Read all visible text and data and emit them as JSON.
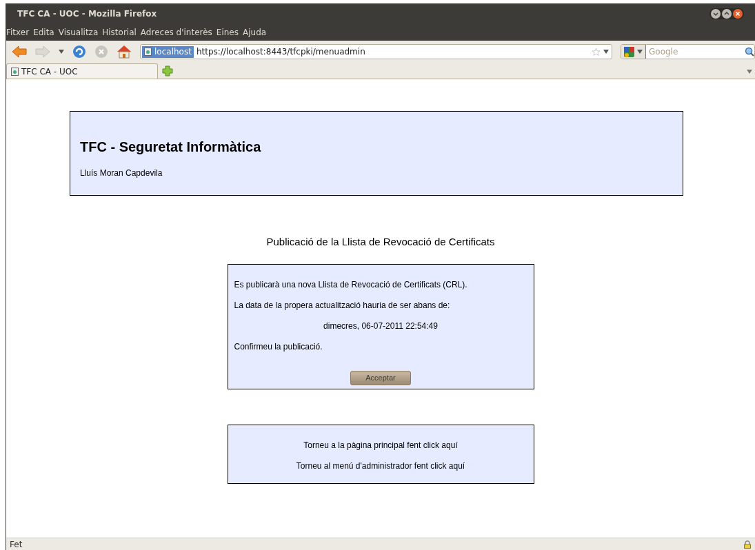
{
  "window": {
    "title": "TFC CA - UOC - Mozilla Firefox"
  },
  "menu": [
    "Fitxer",
    "Edita",
    "Visualitza",
    "Historial",
    "Adreces d'interès",
    "Eines",
    "Ajuda"
  ],
  "address_bar": {
    "site": "localhost",
    "url": "https://localhost:8443/tfcpki/menuadmin"
  },
  "search": {
    "placeholder": "Google"
  },
  "tabs": [
    {
      "label": "TFC CA - UOC",
      "selected": true
    }
  ],
  "header": {
    "title": "TFC - Seguretat Informàtica",
    "author": "Lluís Moran Capdevila"
  },
  "page_title": "Publicació de la Llista de Revocació de Certificats",
  "confirm_box": {
    "lines": [
      "Es publicarà una nova Llista de Revocació de Certificats (CRL).",
      "La data de la propera actualització hauria de ser abans de:"
    ],
    "date": "dimecres, 06-07-2011 22:54:49",
    "prompt": "Confirmeu la publicació.",
    "button": "Acceptar"
  },
  "links": [
    "Torneu a la pàgina principal fent click aquí",
    "Torneu al menú d'administrador fent click aquí"
  ],
  "status_bar": "Fet"
}
